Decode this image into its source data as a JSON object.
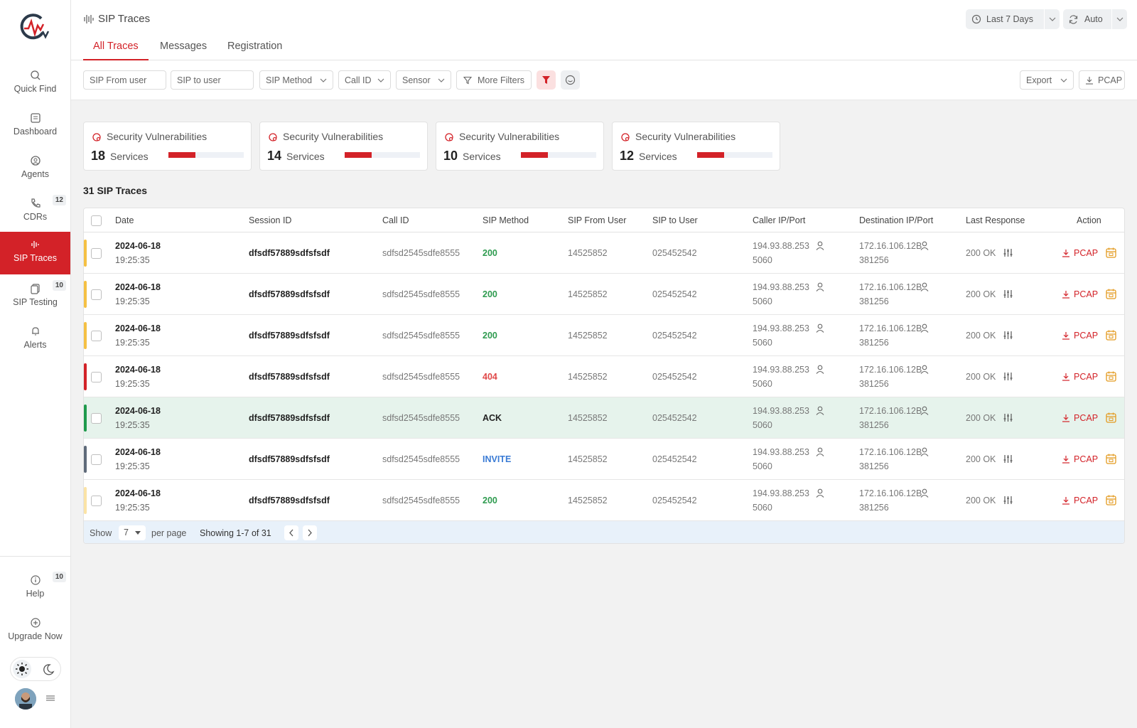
{
  "sidebar": {
    "items": [
      {
        "label": "Quick Find",
        "icon": "search-icon"
      },
      {
        "label": "Dashboard",
        "icon": "dashboard-icon"
      },
      {
        "label": "Agents",
        "icon": "agent-icon"
      },
      {
        "label": "CDRs",
        "icon": "phone-icon",
        "badge": "12"
      },
      {
        "label": "SIP Traces",
        "icon": "waveform-icon",
        "active": true
      },
      {
        "label": "SIP Testing",
        "icon": "copy-icon",
        "badge": "10"
      },
      {
        "label": "Alerts",
        "icon": "bell-icon"
      }
    ],
    "bottom": [
      {
        "label": "Help",
        "icon": "help-icon",
        "badge": "10"
      },
      {
        "label": "Upgrade Now",
        "icon": "plus-circle-icon"
      }
    ]
  },
  "header": {
    "title": "SIP Traces",
    "tabs": [
      "All Traces",
      "Messages",
      "Registration"
    ],
    "time_range": "Last 7 Days",
    "refresh": "Auto"
  },
  "filters": {
    "from_user_placeholder": "SIP From user",
    "to_user_placeholder": "SIP to user",
    "method": "SIP Method",
    "call_id": "Call ID",
    "sensor": "Sensor",
    "more": "More Filters",
    "export": "Export",
    "pcap": "PCAP"
  },
  "cards": [
    {
      "title": "Security Vulnerabilities",
      "count": "18",
      "unit": "Services",
      "level": 0.36
    },
    {
      "title": "Security Vulnerabilities",
      "count": "14",
      "unit": "Services",
      "level": 0.36
    },
    {
      "title": "Security Vulnerabilities",
      "count": "10",
      "unit": "Services",
      "level": 0.36
    },
    {
      "title": "Security Vulnerabilities",
      "count": "12",
      "unit": "Services",
      "level": 0.36
    }
  ],
  "traces_title": "31 SIP Traces",
  "table": {
    "headers": [
      "Date",
      "Session ID",
      "Call ID",
      "SIP Method",
      "SIP From User",
      "SIP to User",
      "Caller IP/Port",
      "Destination IP/Port",
      "Last Response",
      "Action"
    ],
    "rows": [
      {
        "date": "2024-06-18",
        "time": "19:25:35",
        "session": "dfsdf57889sdfsfsdf",
        "call_id": "sdfsd2545sdfe8555",
        "method": "200",
        "method_color": "#2e9b4f",
        "stripe": "#f5c043",
        "from": "14525852",
        "to": "025452542",
        "caller_ip": "194.93.88.253",
        "caller_port": "5060",
        "dest_ip": "172.16.106.12B",
        "dest_port": "381256",
        "response": "200 OK",
        "action": "PCAP"
      },
      {
        "date": "2024-06-18",
        "time": "19:25:35",
        "session": "dfsdf57889sdfsfsdf",
        "call_id": "sdfsd2545sdfe8555",
        "method": "200",
        "method_color": "#2e9b4f",
        "stripe": "#f5c043",
        "from": "14525852",
        "to": "025452542",
        "caller_ip": "194.93.88.253",
        "caller_port": "5060",
        "dest_ip": "172.16.106.12B",
        "dest_port": "381256",
        "response": "200 OK",
        "action": "PCAP"
      },
      {
        "date": "2024-06-18",
        "time": "19:25:35",
        "session": "dfsdf57889sdfsfsdf",
        "call_id": "sdfsd2545sdfe8555",
        "method": "200",
        "method_color": "#2e9b4f",
        "stripe": "#f5c043",
        "from": "14525852",
        "to": "025452542",
        "caller_ip": "194.93.88.253",
        "caller_port": "5060",
        "dest_ip": "172.16.106.12B",
        "dest_port": "381256",
        "response": "200 OK",
        "action": "PCAP"
      },
      {
        "date": "2024-06-18",
        "time": "19:25:35",
        "session": "dfsdf57889sdfsfsdf",
        "call_id": "sdfsd2545sdfe8555",
        "method": "404",
        "method_color": "#e04848",
        "stripe": "#d32228",
        "from": "14525852",
        "to": "025452542",
        "caller_ip": "194.93.88.253",
        "caller_port": "5060",
        "dest_ip": "172.16.106.12B",
        "dest_port": "381256",
        "response": "200 OK",
        "action": "PCAP"
      },
      {
        "date": "2024-06-18",
        "time": "19:25:35",
        "session": "dfsdf57889sdfsfsdf",
        "call_id": "sdfsd2545sdfe8555",
        "method": "ACK",
        "method_color": "#222222",
        "stripe": "#1f9a4c",
        "highlight": true,
        "from": "14525852",
        "to": "025452542",
        "caller_ip": "194.93.88.253",
        "caller_port": "5060",
        "dest_ip": "172.16.106.12B",
        "dest_port": "381256",
        "response": "200 OK",
        "action": "PCAP"
      },
      {
        "date": "2024-06-18",
        "time": "19:25:35",
        "session": "dfsdf57889sdfsfsdf",
        "call_id": "sdfsd2545sdfe8555",
        "method": "INVITE",
        "method_color": "#3a7bd5",
        "stripe": "#5f6b7a",
        "from": "14525852",
        "to": "025452542",
        "caller_ip": "194.93.88.253",
        "caller_port": "5060",
        "dest_ip": "172.16.106.12B",
        "dest_port": "381256",
        "response": "200 OK",
        "action": "PCAP"
      },
      {
        "date": "2024-06-18",
        "time": "19:25:35",
        "session": "dfsdf57889sdfsfsdf",
        "call_id": "sdfsd2545sdfe8555",
        "method": "200",
        "method_color": "#2e9b4f",
        "stripe": "#fbe3a6",
        "from": "14525852",
        "to": "025452542",
        "caller_ip": "194.93.88.253",
        "caller_port": "5060",
        "dest_ip": "172.16.106.12B",
        "dest_port": "381256",
        "response": "200 OK",
        "action": "PCAP"
      }
    ]
  },
  "pagination": {
    "show": "Show",
    "per_page_value": "7",
    "per_page": "per page",
    "showing": "Showing 1-7 of 31"
  },
  "colors": {
    "accent": "#d32228",
    "success": "#2e9b4f"
  }
}
